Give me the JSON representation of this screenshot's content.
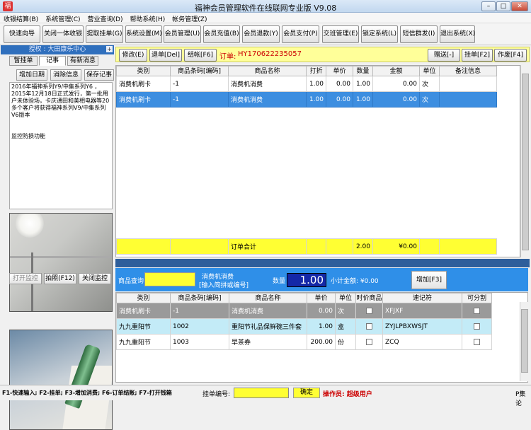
{
  "window": {
    "title": "福神会员管理软件在线联网专业版 V9.08",
    "buttons": [
      "–",
      "□",
      "✕"
    ]
  },
  "menu": [
    "收银结算(B)",
    "系统管理(C)",
    "营业查询(D)",
    "帮助系统(H)",
    "帐务管理(Z)"
  ],
  "toolbar": [
    "快速向导",
    "关闭一体收银",
    "提取挂单(G)",
    "系统设置(M)",
    "会员管理(U)",
    "会员充值(B)",
    "会员退款(Y)",
    "会员支付(P)",
    "交班管理(E)",
    "锁定系统(L)",
    "短信群发(I)",
    "退出系统(X)"
  ],
  "left": {
    "header": "授权 : 大田康乐中心",
    "pin": "+",
    "tabs": [
      "暂挂单",
      "记事",
      "有新消息"
    ],
    "buttons": [
      "增加日期",
      "消除信息",
      "保存记事"
    ],
    "notes": "2016年福神系列Y9/中集系列Y6 ，2015年12月18日正式发行，第一批用户未体验场，卡庆通田和美相电器等20多个客户将获得福神系列V9/中集系列V6版本\n\n\n监控防损功能",
    "cam_buttons": [
      "打开监控",
      "拍照(F12)",
      "关闭监控"
    ]
  },
  "order": {
    "left_buttons": [
      "修改(E)",
      "退单[Del]",
      "结帐[F6]"
    ],
    "label": "订单:",
    "number": "HY170622235057",
    "right_buttons": [
      "赠送[-]",
      "挂单[F2]",
      "作废[F4]"
    ]
  },
  "order_table": {
    "headers": [
      "类别",
      "商品条码[编码]",
      "商品名称",
      "打折",
      "单价",
      "数量",
      "金额",
      "单位",
      "备注信息"
    ],
    "rows": [
      [
        "消费机刷卡",
        "-1",
        "消费机消费",
        "1.00",
        "0.00",
        "1.00",
        "0.00",
        "次",
        ""
      ],
      [
        "消费机刷卡",
        "-1",
        "消费机消费",
        "1.00",
        "0.00",
        "1.00",
        "0.00",
        "次",
        ""
      ]
    ],
    "total": {
      "label": "订单合计",
      "qty": "2.00",
      "amount": "¥0.00"
    }
  },
  "query": {
    "label": "商品查询",
    "hint1": "消费机消费",
    "hint2": "[输入简拼或编号]",
    "qty_label": "数量",
    "qty_value": "1.00",
    "subtotal": "小计金额: ¥0.00",
    "add_button": "增加[F3]"
  },
  "product_table": {
    "headers": [
      "类别",
      "商品条码[编码]",
      "商品名称",
      "单价",
      "单位",
      "时价商品",
      "速记符",
      "可分割"
    ],
    "rows": [
      [
        "消费机刷卡",
        "-1",
        "消费机消费",
        "0.00",
        "次",
        "",
        "XFJXF",
        ""
      ],
      [
        "九九重阳节",
        "1002",
        "重阳节礼品保鲜碗三件套",
        "1.00",
        "盒",
        "",
        "ZYJLPBXWSJT",
        ""
      ],
      [
        "九九重阳节",
        "1003",
        "早茶券",
        "200.00",
        "份",
        "",
        "ZCQ",
        ""
      ]
    ]
  },
  "status": {
    "shortcuts": "F1-快速输入; F2-挂单; F3-增加消费; F6-订单结账; F7-打开钱箱",
    "hang_label": "挂单编号:",
    "confirm": "确定",
    "operator": "操作员: 超级用户",
    "right": "P集论"
  },
  "colors": {
    "accent_blue": "#2f8fe8",
    "selection": "#3d8ee0",
    "yellow": "#ffff33",
    "order_red": "#cc0000",
    "qty_bg": "#1428a8"
  }
}
